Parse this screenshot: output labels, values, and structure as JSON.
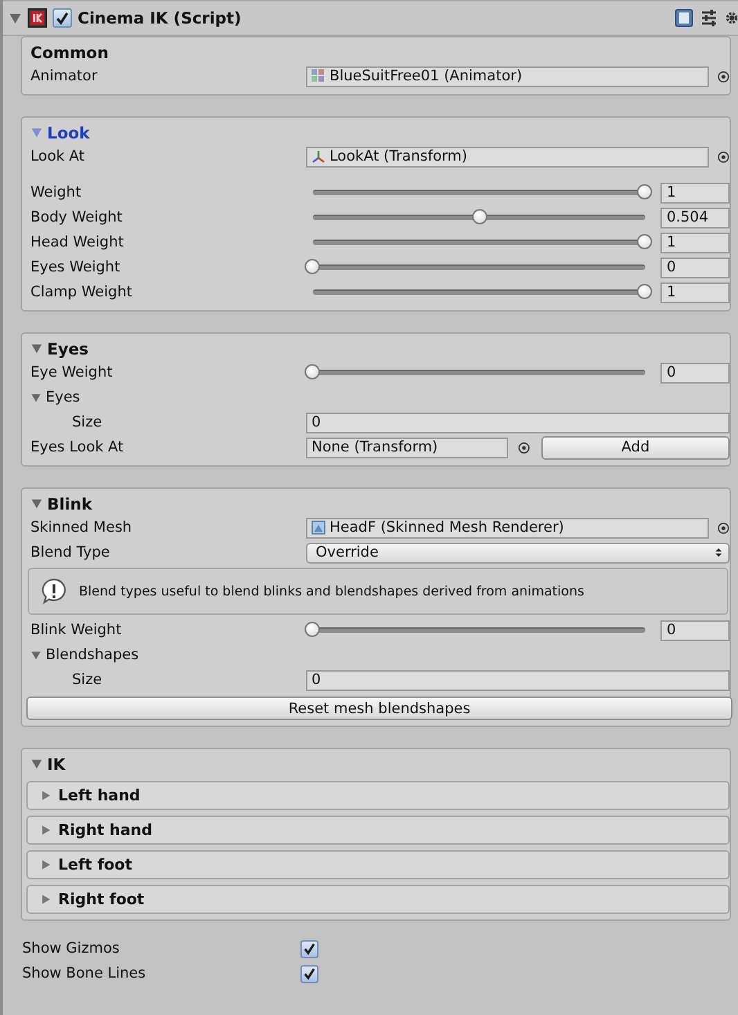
{
  "header": {
    "title": "Cinema IK (Script)",
    "expanded": true,
    "enabled": true
  },
  "sections": [
    {
      "title": "Common",
      "kind": "plain",
      "focused": false,
      "rows": [
        {
          "kind": "object",
          "label": "Animator",
          "value": "BlueSuitFree01 (Animator)"
        }
      ]
    },
    {
      "title": "Look",
      "kind": "foldout",
      "expanded": true,
      "focused": true,
      "rows": [
        {
          "kind": "object",
          "label": "Look At",
          "value": "LookAt (Transform)"
        },
        {
          "kind": "gap"
        },
        {
          "kind": "slider",
          "label": "Weight",
          "level": 1,
          "value": "1"
        },
        {
          "kind": "slider",
          "label": "Body Weight",
          "level": 0.504,
          "value": "0.504"
        },
        {
          "kind": "slider",
          "label": "Head Weight",
          "level": 1,
          "value": "1"
        },
        {
          "kind": "slider",
          "label": "Eyes Weight",
          "level": 0,
          "value": "0"
        },
        {
          "kind": "slider",
          "label": "Clamp Weight",
          "level": 1,
          "value": "1"
        }
      ]
    },
    {
      "title": "Eyes",
      "kind": "foldout",
      "expanded": true,
      "focused": false,
      "rows": [
        {
          "kind": "slider",
          "label": "Eye Weight",
          "level": 0,
          "value": "0"
        },
        {
          "kind": "foldout",
          "label": "Eyes",
          "expanded": true,
          "children": [
            {
              "kind": "int",
              "label": "Size",
              "value": "0"
            }
          ]
        },
        {
          "kind": "objectbutton",
          "label": "Eyes Look At",
          "value": "None (Transform)",
          "button": "Add"
        }
      ]
    },
    {
      "title": "Blink",
      "kind": "foldout",
      "expanded": true,
      "focused": false,
      "rows": [
        {
          "kind": "object",
          "label": "Skinned Mesh",
          "value": "HeadF (Skinned Mesh Renderer)"
        },
        {
          "kind": "dropdown",
          "label": "Blend Type",
          "value": "Override"
        },
        {
          "kind": "help",
          "text": "Blend types useful to blend blinks and blendshapes derived from animations"
        },
        {
          "kind": "slider",
          "label": "Blink Weight",
          "level": 0,
          "value": "0"
        },
        {
          "kind": "foldout",
          "label": "Blendshapes",
          "expanded": true,
          "children": [
            {
              "kind": "int",
              "label": "Size",
              "value": "0"
            }
          ]
        },
        {
          "kind": "button",
          "label": "Reset mesh blendshapes"
        }
      ]
    },
    {
      "title": "IK",
      "kind": "foldout",
      "expanded": true,
      "focused": false,
      "rows": [
        {
          "kind": "subbox",
          "label": "Left hand",
          "expanded": false
        },
        {
          "kind": "subbox",
          "label": "Right hand",
          "expanded": false
        },
        {
          "kind": "subbox",
          "label": "Left foot",
          "expanded": false
        },
        {
          "kind": "subbox",
          "label": "Right foot",
          "expanded": false
        }
      ]
    }
  ],
  "toggles": [
    {
      "label": "Show Gizmos",
      "checked": true
    },
    {
      "label": "Show Bone Lines",
      "checked": true
    }
  ]
}
